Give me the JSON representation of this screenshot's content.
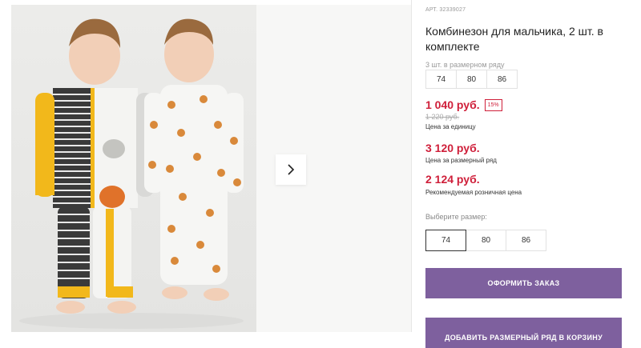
{
  "product": {
    "article": "АРТ. 32339027",
    "title": "Комбинезон для мальчика, 2 шт. в комплекте"
  },
  "size_range": {
    "label": "3 шт. в размерном ряду",
    "sizes": [
      "74",
      "80",
      "86"
    ]
  },
  "pricing": {
    "price": "1 040 руб.",
    "discount_badge": "15%",
    "old_price": "1 220 руб.",
    "unit_caption": "Цена за единицу",
    "range_price": "3 120 руб.",
    "range_caption": "Цена за размерный ряд",
    "retail_price": "2 124 руб.",
    "retail_caption": "Рекомендуемая розничная цена"
  },
  "size_select": {
    "label": "Выберите размер:",
    "options": [
      "74",
      "80",
      "86"
    ],
    "selected": "74"
  },
  "buttons": {
    "order": "ОФОРМИТЬ ЗАКАЗ",
    "add_range": "ДОБАВИТЬ РАЗМЕРНЫЙ РЯД В КОРЗИНУ"
  },
  "colors": {
    "accent_purple": "#7e609e",
    "price_red": "#cf1f3a"
  },
  "icons": {
    "next": "chevron-right-icon"
  }
}
